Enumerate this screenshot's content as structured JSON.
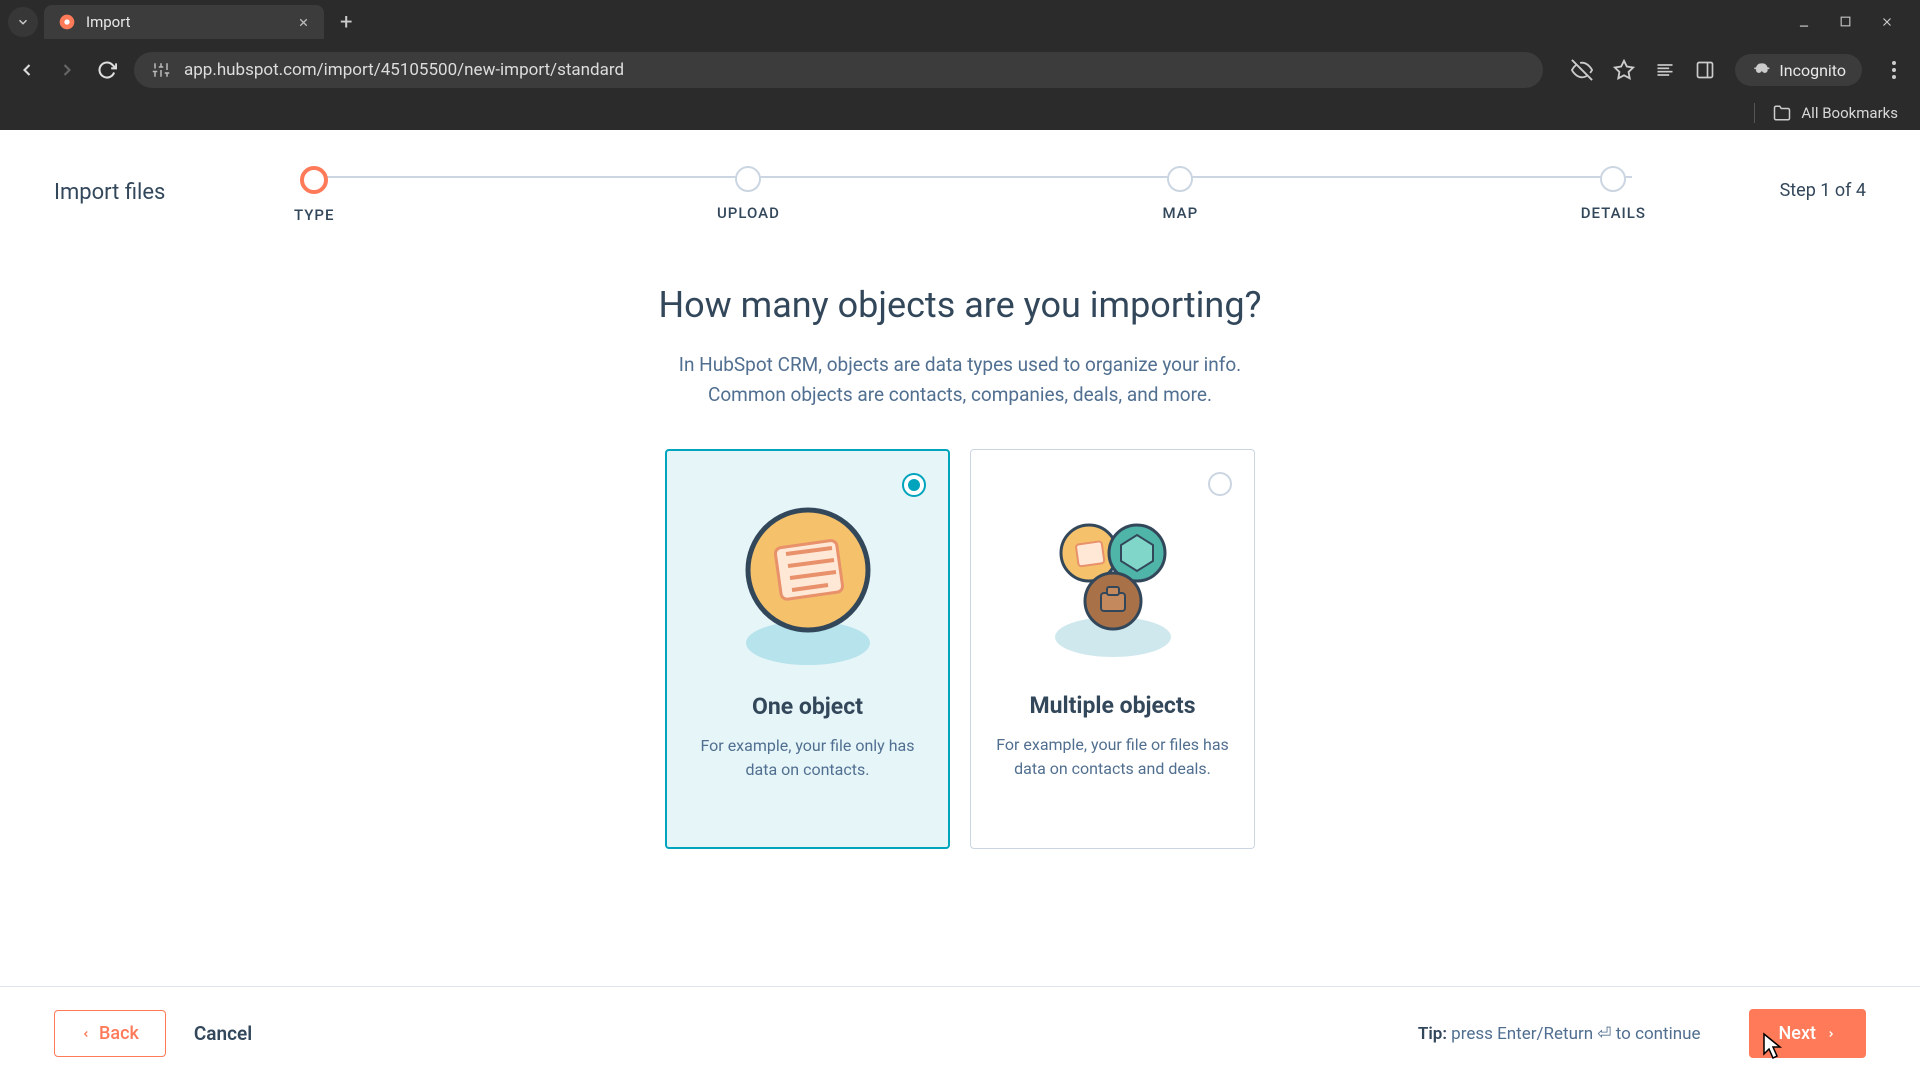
{
  "browser": {
    "tab_title": "Import",
    "url": "app.hubspot.com/import/45105500/new-import/standard",
    "incognito_label": "Incognito",
    "all_bookmarks": "All Bookmarks"
  },
  "header": {
    "page_title": "Import files",
    "step_counter": "Step 1 of 4",
    "steps": [
      "TYPE",
      "UPLOAD",
      "MAP",
      "DETAILS"
    ]
  },
  "main": {
    "heading": "How many objects are you importing?",
    "subtitle_l1": "In HubSpot CRM, objects are data types used to organize your info.",
    "subtitle_l2": "Common objects are contacts, companies, deals, and more.",
    "cards": {
      "one": {
        "title": "One object",
        "desc": "For example, your file only has data on contacts."
      },
      "multi": {
        "title": "Multiple objects",
        "desc": "For example, your file or files has data on contacts and deals."
      }
    }
  },
  "footer": {
    "back": "Back",
    "cancel": "Cancel",
    "tip_bold": "Tip:",
    "tip_text": " press Enter/Return ⏎ to continue",
    "next": "Next"
  },
  "colors": {
    "accent_orange": "#ff7a59",
    "accent_teal": "#00a4bd",
    "text_primary": "#33475b",
    "text_secondary": "#516f90"
  }
}
